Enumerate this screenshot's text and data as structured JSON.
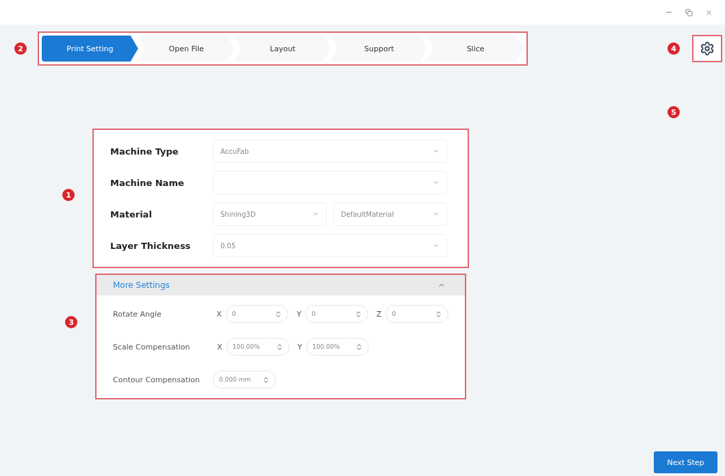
{
  "steps": [
    {
      "label": "Print Setting",
      "selected": true
    },
    {
      "label": "Open File",
      "selected": false
    },
    {
      "label": "Layout",
      "selected": false
    },
    {
      "label": "Support",
      "selected": false
    },
    {
      "label": "Slice",
      "selected": false
    }
  ],
  "stepper_marker": "2",
  "settings_marker": "4",
  "free_marker": "5",
  "form": {
    "marker": "1",
    "rows": [
      {
        "label": "Machine Type",
        "selects": [
          {
            "value": "AccuFab"
          }
        ]
      },
      {
        "label": "Machine Name"
      },
      {
        "label": "Material",
        "selects": [
          {
            "value": "Shining3D"
          },
          {
            "value": "DefaultMaterial"
          }
        ]
      },
      {
        "label": "Layer Thickness",
        "selects": [
          {
            "value": "0.05"
          }
        ]
      }
    ]
  },
  "more_settings": {
    "marker": "3",
    "title": "More Settings",
    "expanded": true,
    "rows": [
      {
        "label": "Rotate Angle",
        "fields": [
          {
            "axis": "X",
            "value": "0"
          },
          {
            "axis": "Y",
            "value": "0"
          },
          {
            "axis": "Z",
            "value": "0"
          }
        ]
      },
      {
        "label": "Scale Compensation",
        "fields": [
          {
            "axis": "X",
            "value": "100.00%"
          },
          {
            "axis": "Y",
            "value": "100.00%"
          }
        ]
      },
      {
        "label": "Contour Compensation",
        "fields": [
          {
            "value": "0.000 mm"
          }
        ]
      }
    ]
  },
  "next_button": "Next Step"
}
